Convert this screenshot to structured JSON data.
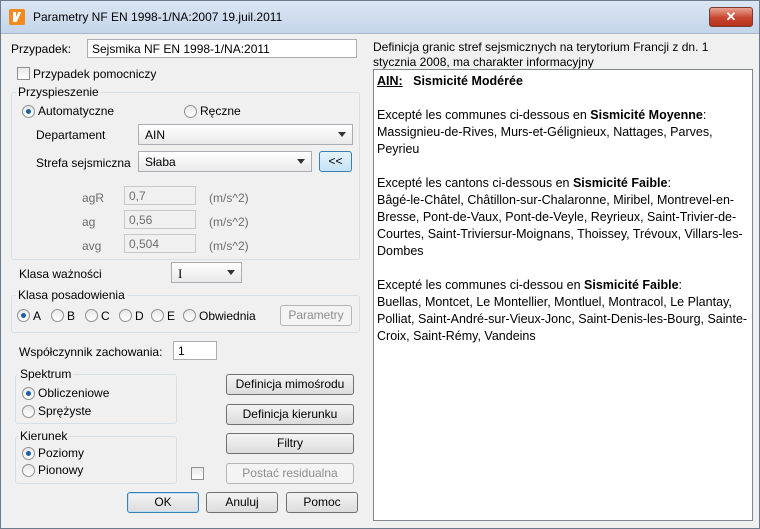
{
  "window": {
    "title": "Parametry   NF EN 1998-1/NA:2007 19.juil.2011",
    "close_label": "✕"
  },
  "case": {
    "label": "Przypadek:",
    "value": "Sejsmika NF EN 1998-1/NA:2011",
    "aux_label": "Przypadek pomocniczy"
  },
  "acceleration": {
    "group_title": "Przyspieszenie",
    "auto_label": "Automatyczne",
    "manual_label": "Ręczne",
    "dept_label": "Departament",
    "dept_value": "AIN",
    "zone_label": "Strefa sejsmiczna",
    "zone_value": "Słaba",
    "zone_button": "<<",
    "agr_label": "agR",
    "agr_value": "0,7",
    "ag_label": "ag",
    "ag_value": "0,56",
    "avg_label": "avg",
    "avg_value": "0,504",
    "unit": "(m/s^2)"
  },
  "importance": {
    "label": "Klasa ważności",
    "value": "I"
  },
  "foundation": {
    "group_title": "Klasa posadowienia",
    "options": [
      "A",
      "B",
      "C",
      "D",
      "E",
      "Obwiednia"
    ],
    "selected": "A",
    "params_button": "Parametry"
  },
  "behavior": {
    "label": "Współczynnik zachowania:",
    "value": "1"
  },
  "spectrum": {
    "group_title": "Spektrum",
    "opt1": "Obliczeniowe",
    "opt2": "Sprężyste"
  },
  "direction": {
    "group_title": "Kierunek",
    "opt1": "Poziomy",
    "opt2": "Pionowy"
  },
  "buttons": {
    "eccentricity": "Definicja mimośrodu",
    "direction_def": "Definicja kierunku",
    "filters": "Filtry",
    "residual": "Postać residualna",
    "ok": "OK",
    "cancel": "Anuluj",
    "help": "Pomoc"
  },
  "info": {
    "header": "Definicja granic stref sejsmicznych na terytorium Francji z dn. 1 stycznia 2008, ma charakter informacyjny",
    "title_code": "AIN:",
    "title_name": "Sismicité Modérée",
    "p1_intro": "Excepté les communes ci-dessous en ",
    "p1_bold": "Sismicité Moyenne",
    "p1_text": "Massignieu-de-Rives, Murs-et-Gélignieux, Nattages, Parves, Peyrieu",
    "p2_intro": "Excepté les cantons ci-dessous en ",
    "p2_bold": "Sismicité Faible",
    "p2_text": "Bâgé-le-Châtel, Châtillon-sur-Chalaronne, Miribel, Montrevel-en-Bresse, Pont-de-Vaux, Pont-de-Veyle, Reyrieux, Saint-Trivier-de-Courtes, Saint-Triviersur-Moignans, Thoissey, Trévoux, Villars-les-Dombes",
    "p3_intro": "Excepté les communes ci-dessou en ",
    "p3_bold": "Sismicité Faible",
    "p3_text": "Buellas, Montcet, Le Montellier, Montluel, Montracol, Le Plantay, Polliat, Saint-André-sur-Vieux-Jonc, Saint-Denis-les-Bourg, Sainte-Croix, Saint-Rémy, Vandeins"
  }
}
